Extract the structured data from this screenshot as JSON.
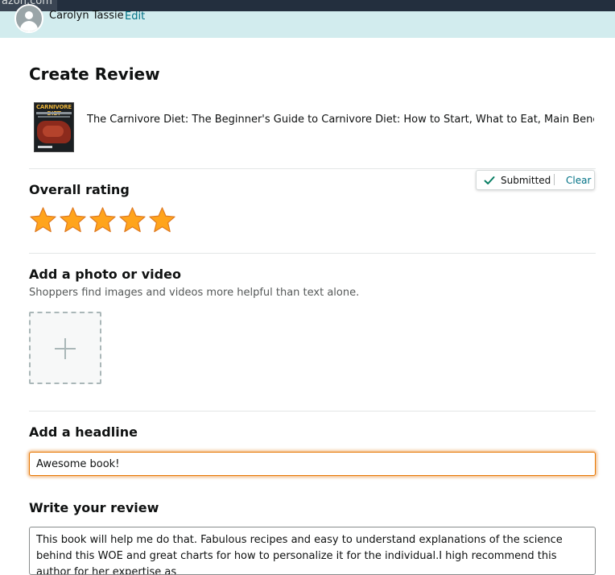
{
  "browser": {
    "domain_fragment": "azon.com"
  },
  "user": {
    "name": "Carolyn Tassie",
    "edit_label": "Edit"
  },
  "page": {
    "title": "Create Review"
  },
  "product": {
    "title": "The Carnivore Diet: The Beginner's Guide to Carnivore Diet: How to Start, What to Eat, Main Benefits. E...",
    "cover_title": "CARNIVORE DIET"
  },
  "rating": {
    "heading": "Overall rating",
    "value": 5,
    "max": 5,
    "star_color": "#FFA41C",
    "status_label": "Submitted",
    "clear_label": "Clear"
  },
  "media": {
    "heading": "Add a photo or video",
    "subtext": "Shoppers find images and videos more helpful than text alone."
  },
  "headline": {
    "heading": "Add a headline",
    "value": "Awesome book!"
  },
  "review": {
    "heading": "Write your review",
    "value": "This book will help me do that. Fabulous recipes and easy to understand explanations of the science behind this WOE and great charts for how to personalize it for the individual.I high recommend this author for her expertise as"
  },
  "colors": {
    "link": "#007185",
    "user_bar": "#D2ECEE",
    "focus": "#E77600",
    "check": "#067D62"
  }
}
